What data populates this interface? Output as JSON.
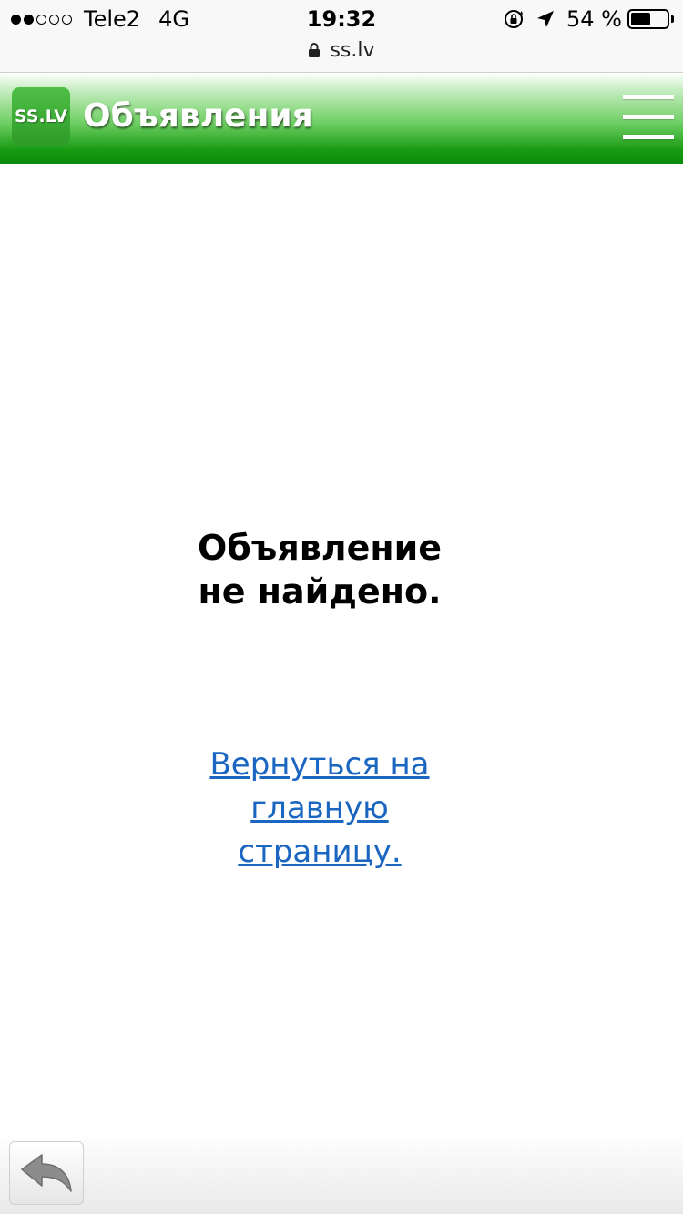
{
  "status_bar": {
    "carrier": "Tele2",
    "network": "4G",
    "time": "19:32",
    "battery_percent_text": "54 %",
    "battery_level": 0.54,
    "signal_bars_filled": 2,
    "signal_bars_total": 5
  },
  "browser": {
    "url": "ss.lv"
  },
  "header": {
    "logo_text": "SS.LV",
    "title": "Объявления"
  },
  "main": {
    "message_line1": "Объявление",
    "message_line2": "не найдено.",
    "link_line1": "Вернуться на",
    "link_line2": "главную",
    "link_line3": "страницу."
  },
  "colors": {
    "header_green": "#179a12",
    "link_blue": "#1a66c0"
  }
}
